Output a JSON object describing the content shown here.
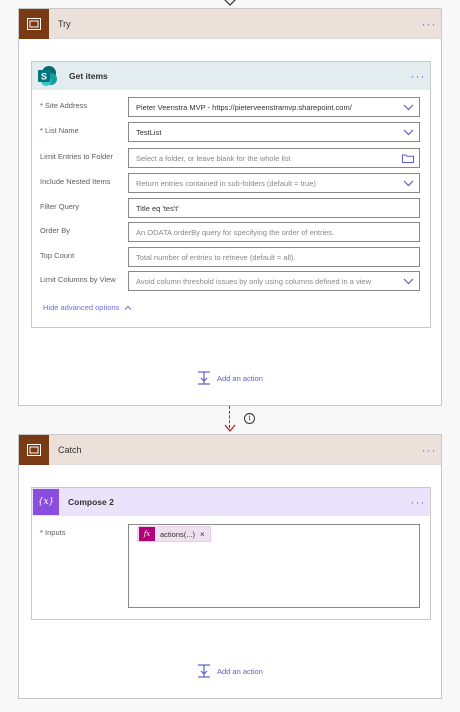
{
  "try_scope": {
    "title": "Try"
  },
  "get_items": {
    "title": "Get items",
    "fields": [
      {
        "label": "Site Address",
        "required": true,
        "value": "Pieter Veenstra MVP - https://pieterveenstramvp.sharepoint.com/",
        "placeholder": "",
        "control": "dropdown"
      },
      {
        "label": "List Name",
        "required": true,
        "value": "TestList",
        "placeholder": "",
        "control": "dropdown"
      },
      {
        "label": "Limit Entries to Folder",
        "required": false,
        "value": "",
        "placeholder": "Select a folder, or leave blank for the whole list",
        "control": "folder"
      },
      {
        "label": "Include Nested Items",
        "required": false,
        "value": "",
        "placeholder": "Return entries contained in sub-folders (default = true)",
        "control": "dropdown"
      },
      {
        "label": "Filter Query",
        "required": false,
        "value": "Title eq 'tes't'",
        "placeholder": "",
        "control": "text"
      },
      {
        "label": "Order By",
        "required": false,
        "value": "",
        "placeholder": "An ODATA orderBy query for specifying the order of entries.",
        "control": "text"
      },
      {
        "label": "Top Count",
        "required": false,
        "value": "",
        "placeholder": "Total number of entries to retrieve (default = all).",
        "control": "text"
      },
      {
        "label": "Limit Columns by View",
        "required": false,
        "value": "",
        "placeholder": "Avoid column threshold issues by only using columns defined in a view",
        "control": "dropdown"
      }
    ],
    "advanced_toggle": "Hide advanced options"
  },
  "try_add_action": "Add an action",
  "catch_scope": {
    "title": "Catch"
  },
  "compose": {
    "title": "Compose 2",
    "inputs_label": "Inputs",
    "token": {
      "fx": "fx",
      "text": "actions(...)",
      "remove": "×"
    }
  },
  "catch_add_action": "Add an action",
  "colors": {
    "scope_header": "#ebe1da",
    "scope_icon": "#7a3a13",
    "sharepoint_header": "#e3ecef",
    "compose_header": "#ebe3fb",
    "compose_icon": "#8a4de0",
    "accent": "#5b5fc7"
  }
}
